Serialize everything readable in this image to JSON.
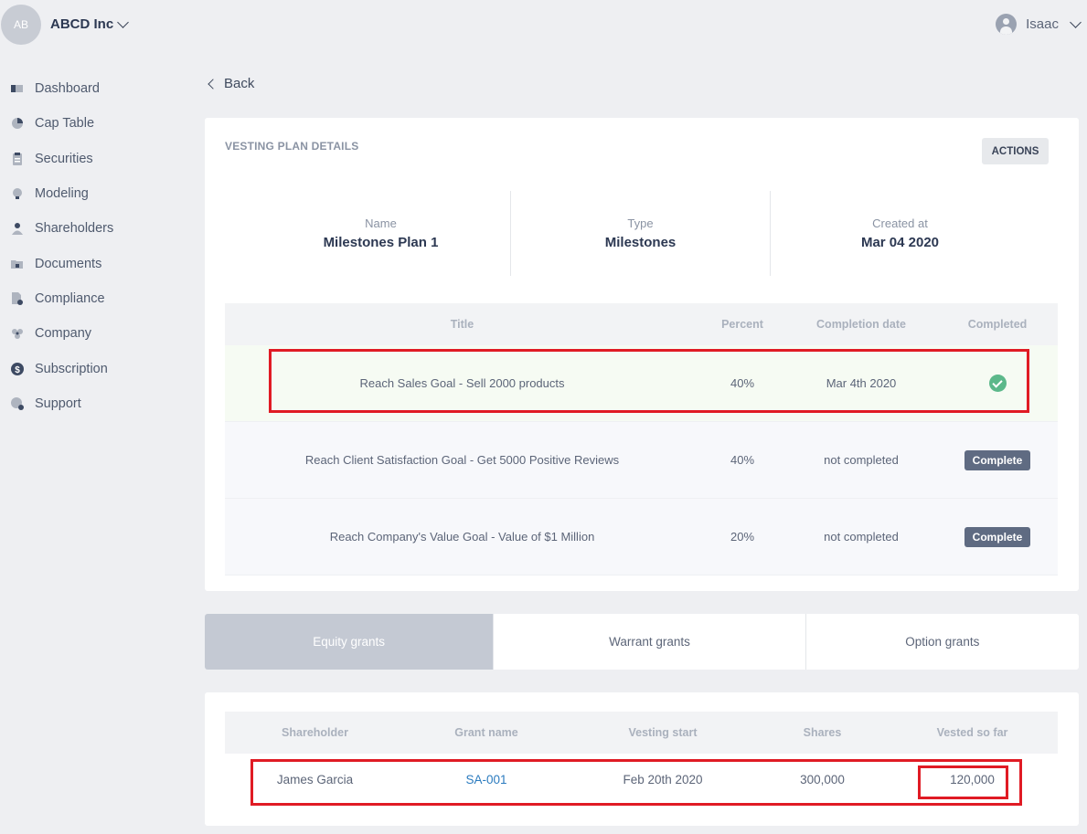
{
  "header": {
    "avatar_initials": "AB",
    "company_name": "ABCD Inc",
    "user_name": "Isaac"
  },
  "sidebar": {
    "items": [
      {
        "label": "Dashboard",
        "icon": "dashboard-icon"
      },
      {
        "label": "Cap Table",
        "icon": "pie-chart-icon"
      },
      {
        "label": "Securities",
        "icon": "clipboard-icon"
      },
      {
        "label": "Modeling",
        "icon": "lightbulb-dollar-icon"
      },
      {
        "label": "Shareholders",
        "icon": "person-icon"
      },
      {
        "label": "Documents",
        "icon": "folder-lock-icon"
      },
      {
        "label": "Compliance",
        "icon": "document-check-icon"
      },
      {
        "label": "Company",
        "icon": "company-icon"
      },
      {
        "label": "Subscription",
        "icon": "dollar-circle-icon"
      },
      {
        "label": "Support",
        "icon": "support-icon"
      }
    ]
  },
  "back_label": "Back",
  "plan": {
    "section_title": "VESTING PLAN DETAILS",
    "actions_label": "ACTIONS",
    "stats": [
      {
        "label": "Name",
        "value": "Milestones Plan 1"
      },
      {
        "label": "Type",
        "value": "Milestones"
      },
      {
        "label": "Created at",
        "value": "Mar 04 2020"
      }
    ]
  },
  "milestones": {
    "headers": [
      "Title",
      "Percent",
      "Completion date",
      "Completed"
    ],
    "complete_button_label": "Complete",
    "rows": [
      {
        "title": "Reach Sales Goal - Sell 2000 products",
        "percent": "40%",
        "date": "Mar 4th 2020",
        "completed": true
      },
      {
        "title": "Reach Client Satisfaction Goal - Get 5000 Positive Reviews",
        "percent": "40%",
        "date": "not completed",
        "completed": false
      },
      {
        "title": "Reach Company's Value Goal - Value of $1 Million",
        "percent": "20%",
        "date": "not completed",
        "completed": false
      }
    ]
  },
  "tabs": [
    {
      "label": "Equity grants",
      "active": true
    },
    {
      "label": "Warrant grants",
      "active": false
    },
    {
      "label": "Option grants",
      "active": false
    }
  ],
  "grants": {
    "headers": [
      "Shareholder",
      "Grant name",
      "Vesting start",
      "Shares",
      "Vested so far"
    ],
    "rows": [
      {
        "shareholder": "James Garcia",
        "grant_name": "SA-001",
        "vesting_start": "Feb 20th 2020",
        "shares": "300,000",
        "vested": "120,000"
      }
    ]
  },
  "colors": {
    "highlight": "#e01b24",
    "success": "#5cb88a",
    "link": "#2b7bbf",
    "active_tab": "#c4c9d3"
  }
}
